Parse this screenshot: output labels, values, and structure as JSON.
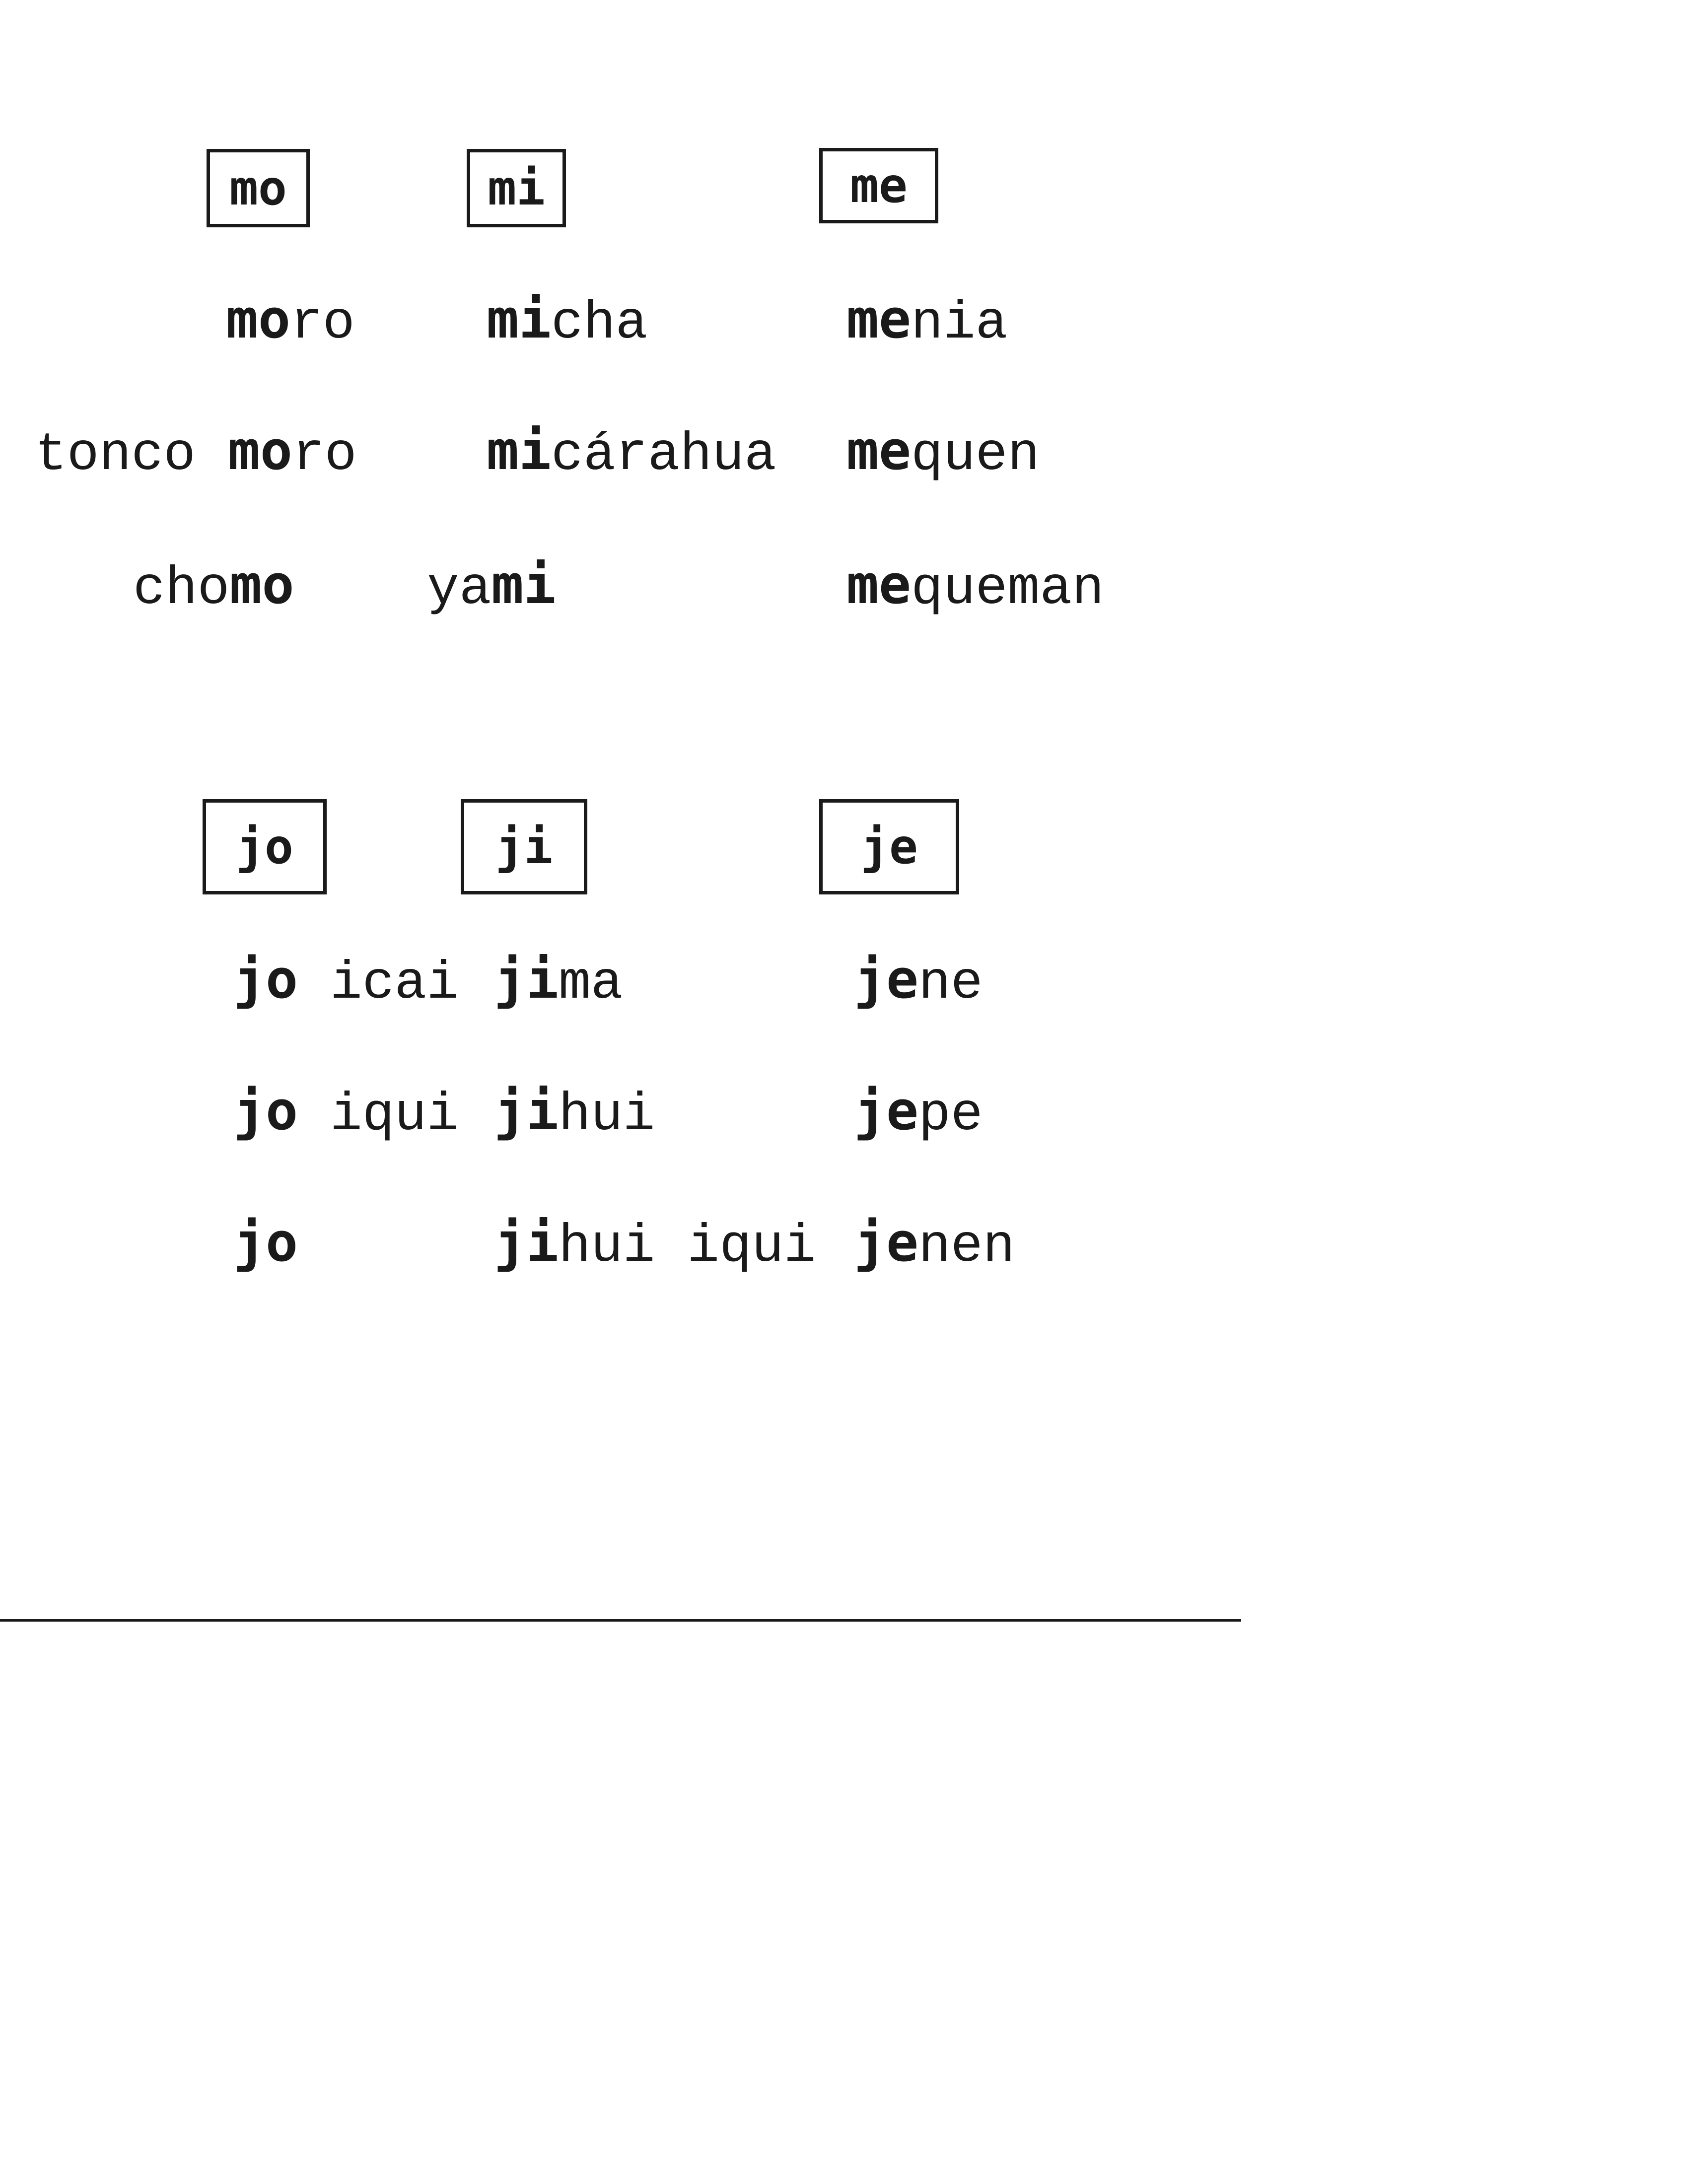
{
  "groups": [
    {
      "syllables": [
        "mo",
        "mi",
        "me"
      ],
      "words": {
        "moro": {
          "bold": "mo",
          "rest": "ro"
        },
        "micha": {
          "bold": "mi",
          "rest": "cha"
        },
        "menia": {
          "bold": "me",
          "rest": "nia"
        },
        "tonco_moro": {
          "pre": "tonco ",
          "bold": "mo",
          "rest": "ro"
        },
        "micarahua": {
          "bold": "mi",
          "rest": "cárahua"
        },
        "mequen": {
          "bold": "me",
          "rest": "quen"
        },
        "chomo": {
          "pre": "cho",
          "bold": "mo"
        },
        "yami": {
          "pre": "ya",
          "bold": "mi"
        },
        "mequeman": {
          "bold": "me",
          "rest": "queman"
        }
      }
    },
    {
      "syllables": [
        "jo",
        "ji",
        "je"
      ],
      "words": {
        "jo_icai": {
          "bold": "jo",
          "rest": " icai"
        },
        "jima": {
          "bold": "ji",
          "rest": "ma"
        },
        "jene": {
          "bold": "je",
          "rest": "ne"
        },
        "jo_iqui": {
          "bold": "jo",
          "rest": " iqui"
        },
        "jihui": {
          "bold": "ji",
          "rest": "hui"
        },
        "jepe": {
          "bold": "je",
          "rest": "pe"
        },
        "jo": {
          "bold": "jo"
        },
        "jihui_iqui": {
          "bold": "ji",
          "rest": "hui iqui"
        },
        "jenen": {
          "bold": "je",
          "rest": "nen"
        }
      }
    }
  ]
}
